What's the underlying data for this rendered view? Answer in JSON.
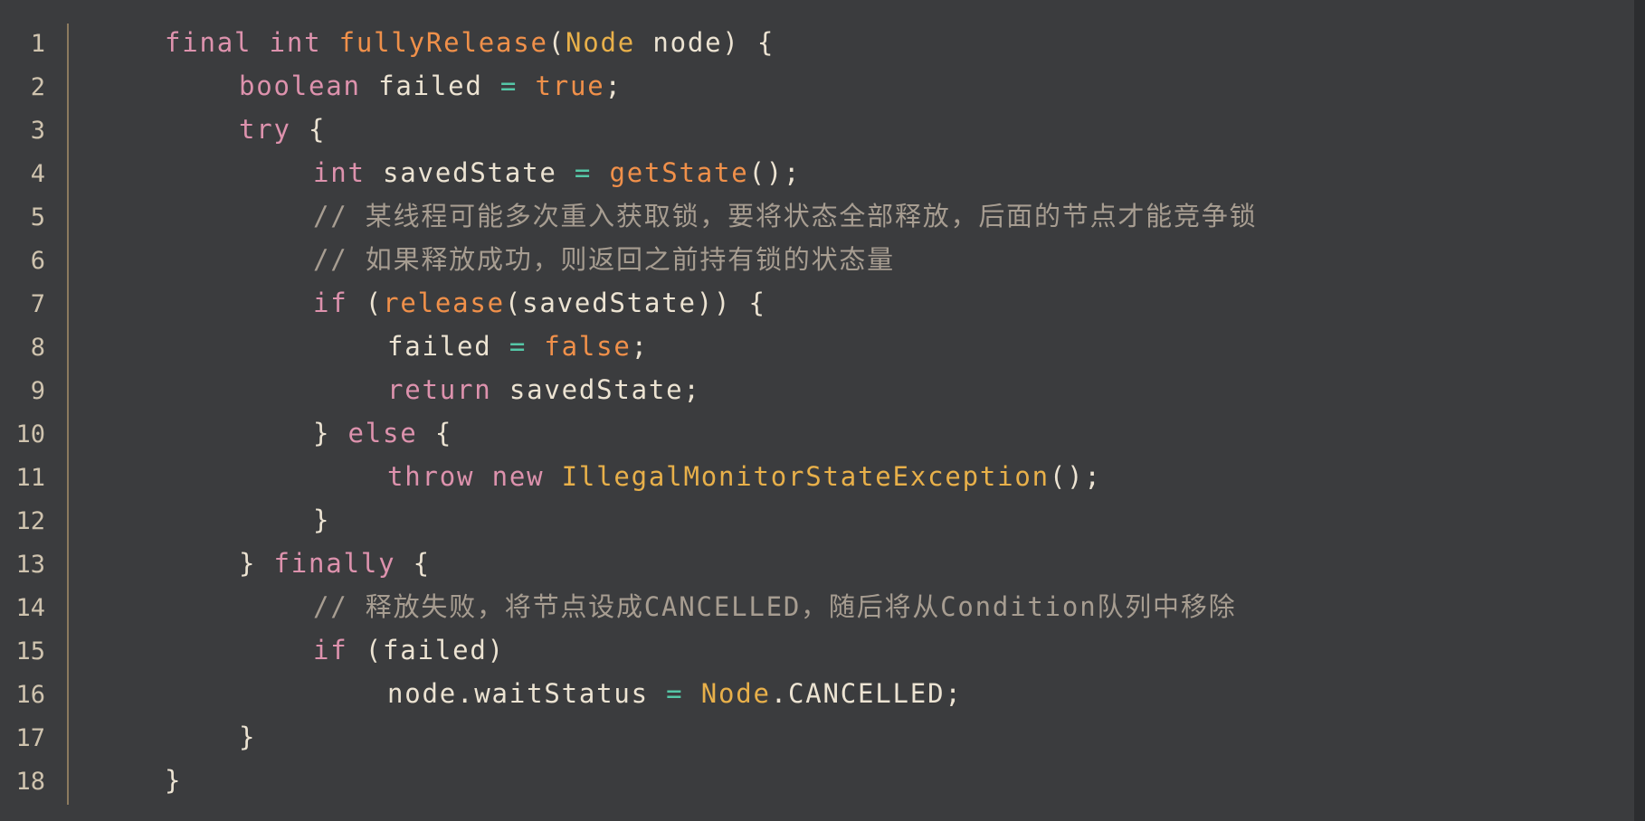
{
  "editor": {
    "lines": [
      {
        "n": "1",
        "indent": 0,
        "tokens": [
          [
            "kw",
            "final"
          ],
          [
            "pl",
            " "
          ],
          [
            "kw",
            "int"
          ],
          [
            "pl",
            " "
          ],
          [
            "fn",
            "fullyRelease"
          ],
          [
            "pl",
            "("
          ],
          [
            "type",
            "Node"
          ],
          [
            "pl",
            " node) {"
          ]
        ]
      },
      {
        "n": "2",
        "indent": 1,
        "tokens": [
          [
            "kw",
            "boolean"
          ],
          [
            "pl",
            " failed "
          ],
          [
            "op",
            "="
          ],
          [
            "pl",
            " "
          ],
          [
            "lit",
            "true"
          ],
          [
            "pl",
            ";"
          ]
        ]
      },
      {
        "n": "3",
        "indent": 1,
        "tokens": [
          [
            "kw",
            "try"
          ],
          [
            "pl",
            " {"
          ]
        ]
      },
      {
        "n": "4",
        "indent": 2,
        "tokens": [
          [
            "kw",
            "int"
          ],
          [
            "pl",
            " savedState "
          ],
          [
            "op",
            "="
          ],
          [
            "pl",
            " "
          ],
          [
            "fn",
            "getState"
          ],
          [
            "pl",
            "();"
          ]
        ]
      },
      {
        "n": "5",
        "indent": 2,
        "tokens": [
          [
            "cm",
            "// 某线程可能多次重入获取锁，要将状态全部释放，后面的节点才能竞争锁"
          ]
        ]
      },
      {
        "n": "6",
        "indent": 2,
        "tokens": [
          [
            "cm",
            "// 如果释放成功，则返回之前持有锁的状态量"
          ]
        ]
      },
      {
        "n": "7",
        "indent": 2,
        "tokens": [
          [
            "kw",
            "if"
          ],
          [
            "pl",
            " ("
          ],
          [
            "fn",
            "release"
          ],
          [
            "pl",
            "(savedState)) {"
          ]
        ]
      },
      {
        "n": "8",
        "indent": 3,
        "tokens": [
          [
            "pl",
            "failed "
          ],
          [
            "op",
            "="
          ],
          [
            "pl",
            " "
          ],
          [
            "lit",
            "false"
          ],
          [
            "pl",
            ";"
          ]
        ]
      },
      {
        "n": "9",
        "indent": 3,
        "tokens": [
          [
            "kw",
            "return"
          ],
          [
            "pl",
            " savedState;"
          ]
        ]
      },
      {
        "n": "10",
        "indent": 2,
        "tokens": [
          [
            "pl",
            "} "
          ],
          [
            "kw",
            "else"
          ],
          [
            "pl",
            " {"
          ]
        ]
      },
      {
        "n": "11",
        "indent": 3,
        "tokens": [
          [
            "kw",
            "throw"
          ],
          [
            "pl",
            " "
          ],
          [
            "kw",
            "new"
          ],
          [
            "pl",
            " "
          ],
          [
            "type",
            "IllegalMonitorStateException"
          ],
          [
            "pl",
            "();"
          ]
        ]
      },
      {
        "n": "12",
        "indent": 2,
        "tokens": [
          [
            "pl",
            "}"
          ]
        ]
      },
      {
        "n": "13",
        "indent": 1,
        "tokens": [
          [
            "pl",
            "} "
          ],
          [
            "kw",
            "finally"
          ],
          [
            "pl",
            " {"
          ]
        ]
      },
      {
        "n": "14",
        "indent": 2,
        "tokens": [
          [
            "cm",
            "// 释放失败，将节点设成CANCELLED，随后将从Condition队列中移除"
          ]
        ]
      },
      {
        "n": "15",
        "indent": 2,
        "tokens": [
          [
            "kw",
            "if"
          ],
          [
            "pl",
            " (failed)"
          ]
        ]
      },
      {
        "n": "16",
        "indent": 3,
        "tokens": [
          [
            "pl",
            "node.waitStatus "
          ],
          [
            "op",
            "="
          ],
          [
            "pl",
            " "
          ],
          [
            "type",
            "Node"
          ],
          [
            "pl",
            ".CANCELLED;"
          ]
        ]
      },
      {
        "n": "17",
        "indent": 1,
        "tokens": [
          [
            "pl",
            "}"
          ]
        ]
      },
      {
        "n": "18",
        "indent": 0,
        "tokens": [
          [
            "pl",
            "}"
          ]
        ]
      }
    ]
  },
  "colors": {
    "background": "#3b3c3e",
    "keyword": "#dd92ad",
    "type": "#e8b04a",
    "function": "#f0904a",
    "operator": "#55c7a7",
    "comment": "#a79d91",
    "plain": "#ece3d2"
  }
}
